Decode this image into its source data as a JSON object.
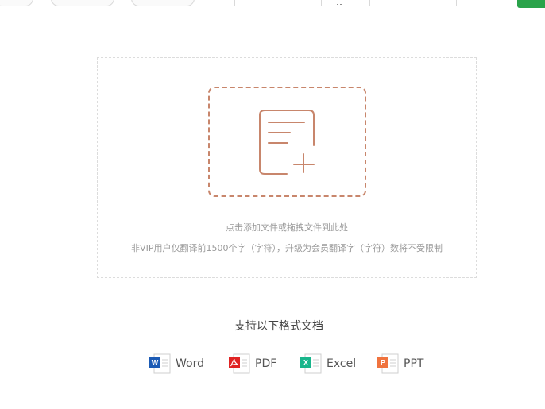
{
  "upload": {
    "hint_primary": "点击添加文件或拖拽文件到此处",
    "hint_secondary": "非VIP用户仅翻译前1500个字（字符），升级为会员翻译字（字符）数将不受限制"
  },
  "formats": {
    "title": "支持以下格式文档",
    "items": [
      {
        "label": "Word",
        "badge": "W",
        "icon": "word-file-icon",
        "color": "#1c5bb5"
      },
      {
        "label": "PDF",
        "badge": "",
        "icon": "pdf-file-icon",
        "color": "#e02424"
      },
      {
        "label": "Excel",
        "badge": "X",
        "icon": "excel-file-icon",
        "color": "#19b58b"
      },
      {
        "label": "PPT",
        "badge": "P",
        "icon": "ppt-file-icon",
        "color": "#f0733e"
      }
    ]
  },
  "colors": {
    "accent_upload": "#c8866c",
    "primary_button": "#2aa34a"
  }
}
